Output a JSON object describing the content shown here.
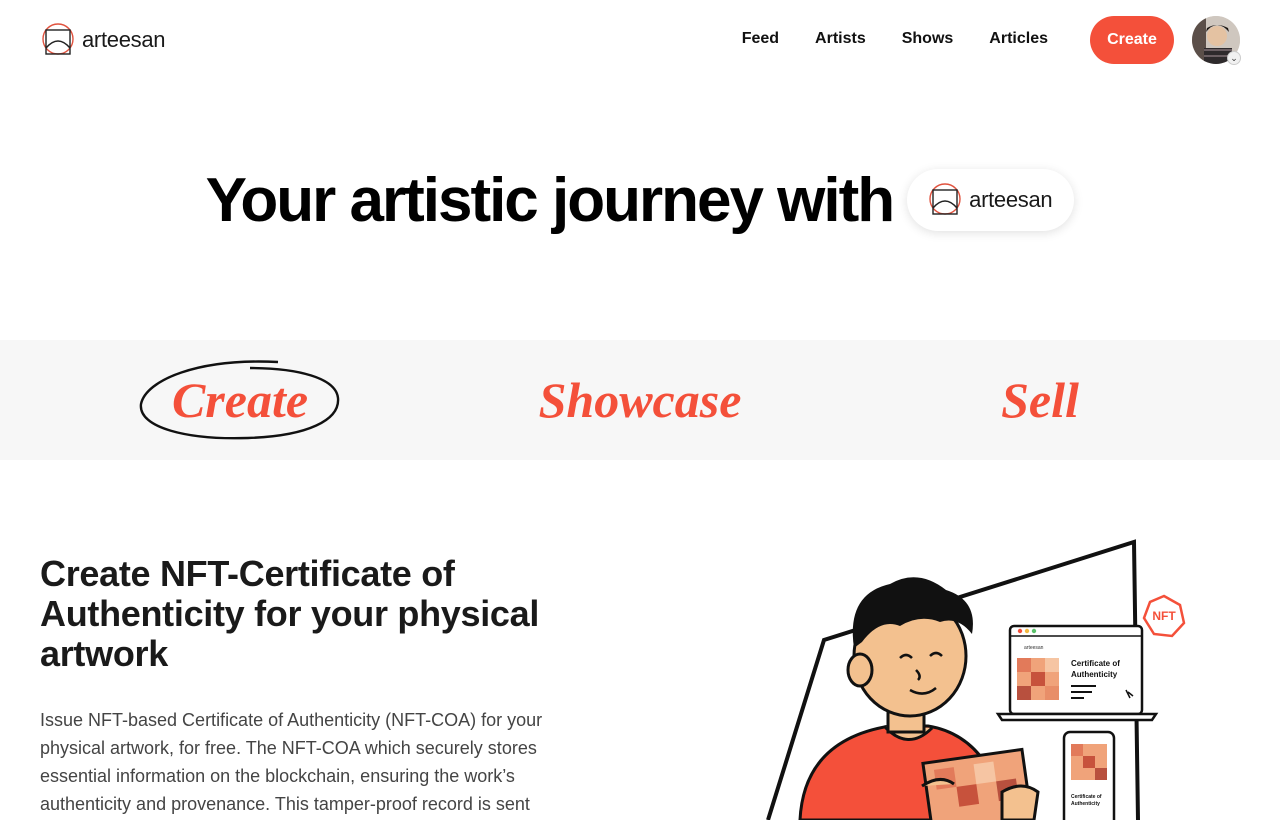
{
  "brand": {
    "name": "arteesan",
    "accent": "#F4503A"
  },
  "nav": {
    "items": [
      "Feed",
      "Artists",
      "Shows",
      "Articles"
    ],
    "create_label": "Create"
  },
  "hero": {
    "title": "Your artistic journey with",
    "pill_name": "arteesan"
  },
  "band": {
    "items": [
      "Create",
      "Showcase",
      "Sell"
    ],
    "selected": "Create"
  },
  "feature": {
    "title": "Create NFT-Certificate of Authenticity for your physical artwork",
    "description": "Issue NFT-based Certificate of Authenticity (NFT-COA) for your physical artwork, for free. The NFT-COA which securely stores essential information on the blockchain, ensuring the work’s authenticity and provenance. This tamper-proof record is sent"
  },
  "illustration": {
    "badge": "NFT",
    "laptop_brand": "arteesan",
    "cert_title": "Certificate of Authenticity",
    "phone_cert_title": "Certificate of Authenticity"
  }
}
